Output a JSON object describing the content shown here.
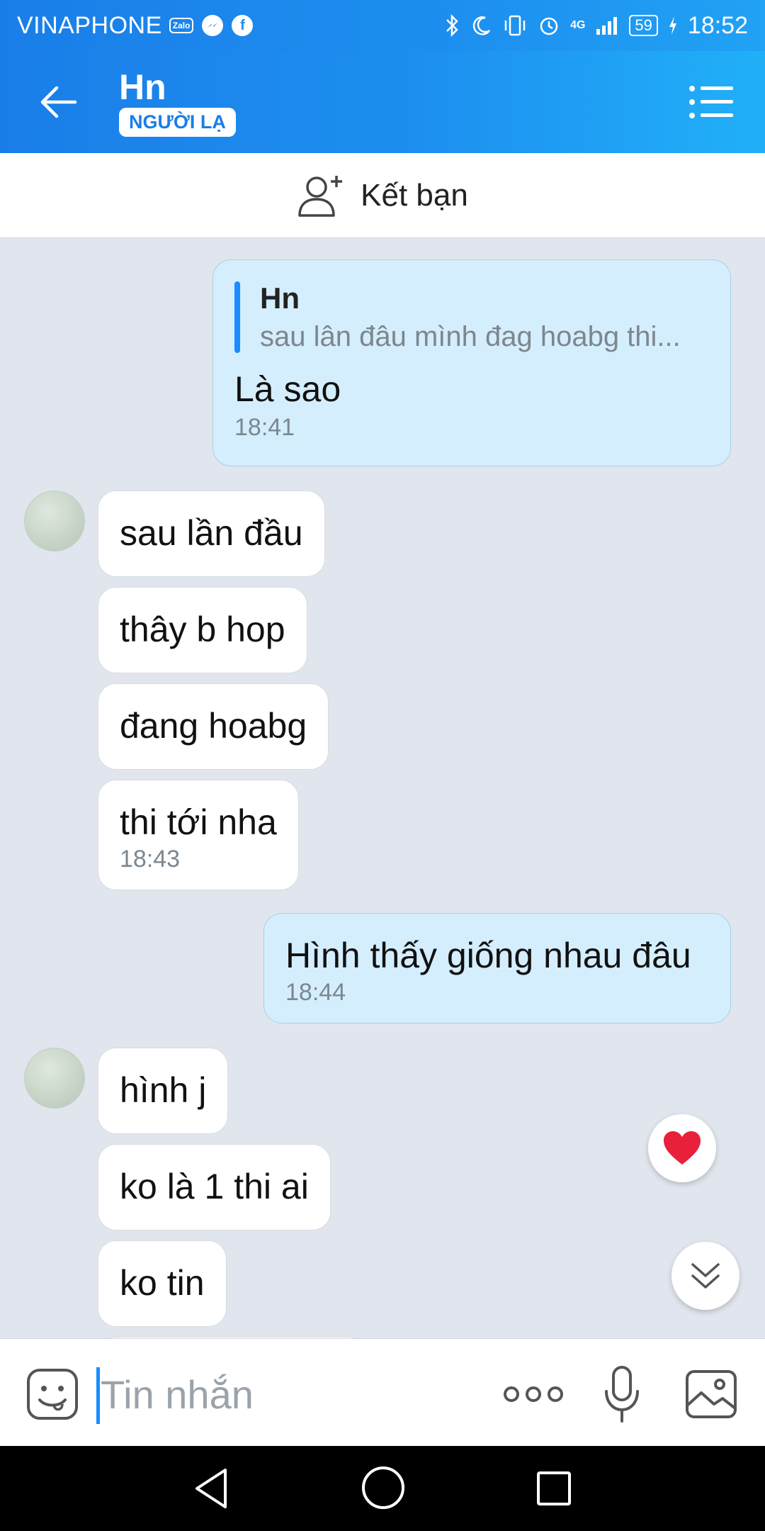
{
  "status_bar": {
    "carrier": "VINAPHONE",
    "zalo_badge": "Zalo",
    "network": "4G",
    "battery": "59",
    "time": "18:52"
  },
  "header": {
    "name": "Hn",
    "badge": "NGƯỜI LẠ"
  },
  "add_friend": {
    "label": "Kết bạn"
  },
  "messages": {
    "m1": {
      "quote_name": "Hn",
      "quote_text": "sau lân đâu mình đag hoabg thi...",
      "text": "Là sao",
      "time": "18:41"
    },
    "m2": {
      "text": "sau lần đầu"
    },
    "m3": {
      "text": "thây b hop"
    },
    "m4": {
      "text": "đang hoabg"
    },
    "m5": {
      "text": "thi tới nha",
      "time": "18:43"
    },
    "m6": {
      "text": "Hình thấy giống nhau đâu",
      "time": "18:44"
    },
    "m7": {
      "text": "hình j"
    },
    "m8": {
      "text": "ko là 1 thi ai"
    },
    "m9": {
      "text": "ko tin"
    }
  },
  "input": {
    "placeholder": "Tin nhắn"
  },
  "icons": {
    "back": "arrow-left-icon",
    "menu": "list-menu-icon",
    "add_friend": "user-plus-icon",
    "reaction": "heart-icon",
    "scroll_down": "double-chevron-down-icon",
    "emoji": "smiley-icon",
    "more": "ellipsis-icon",
    "mic": "microphone-icon",
    "image": "image-icon"
  },
  "colors": {
    "header_blue": "#1d8ff0",
    "outgoing_bubble": "#d4eefd",
    "incoming_bubble": "#ffffff",
    "chat_background": "#e1e6ee",
    "heart": "#e8203a"
  }
}
